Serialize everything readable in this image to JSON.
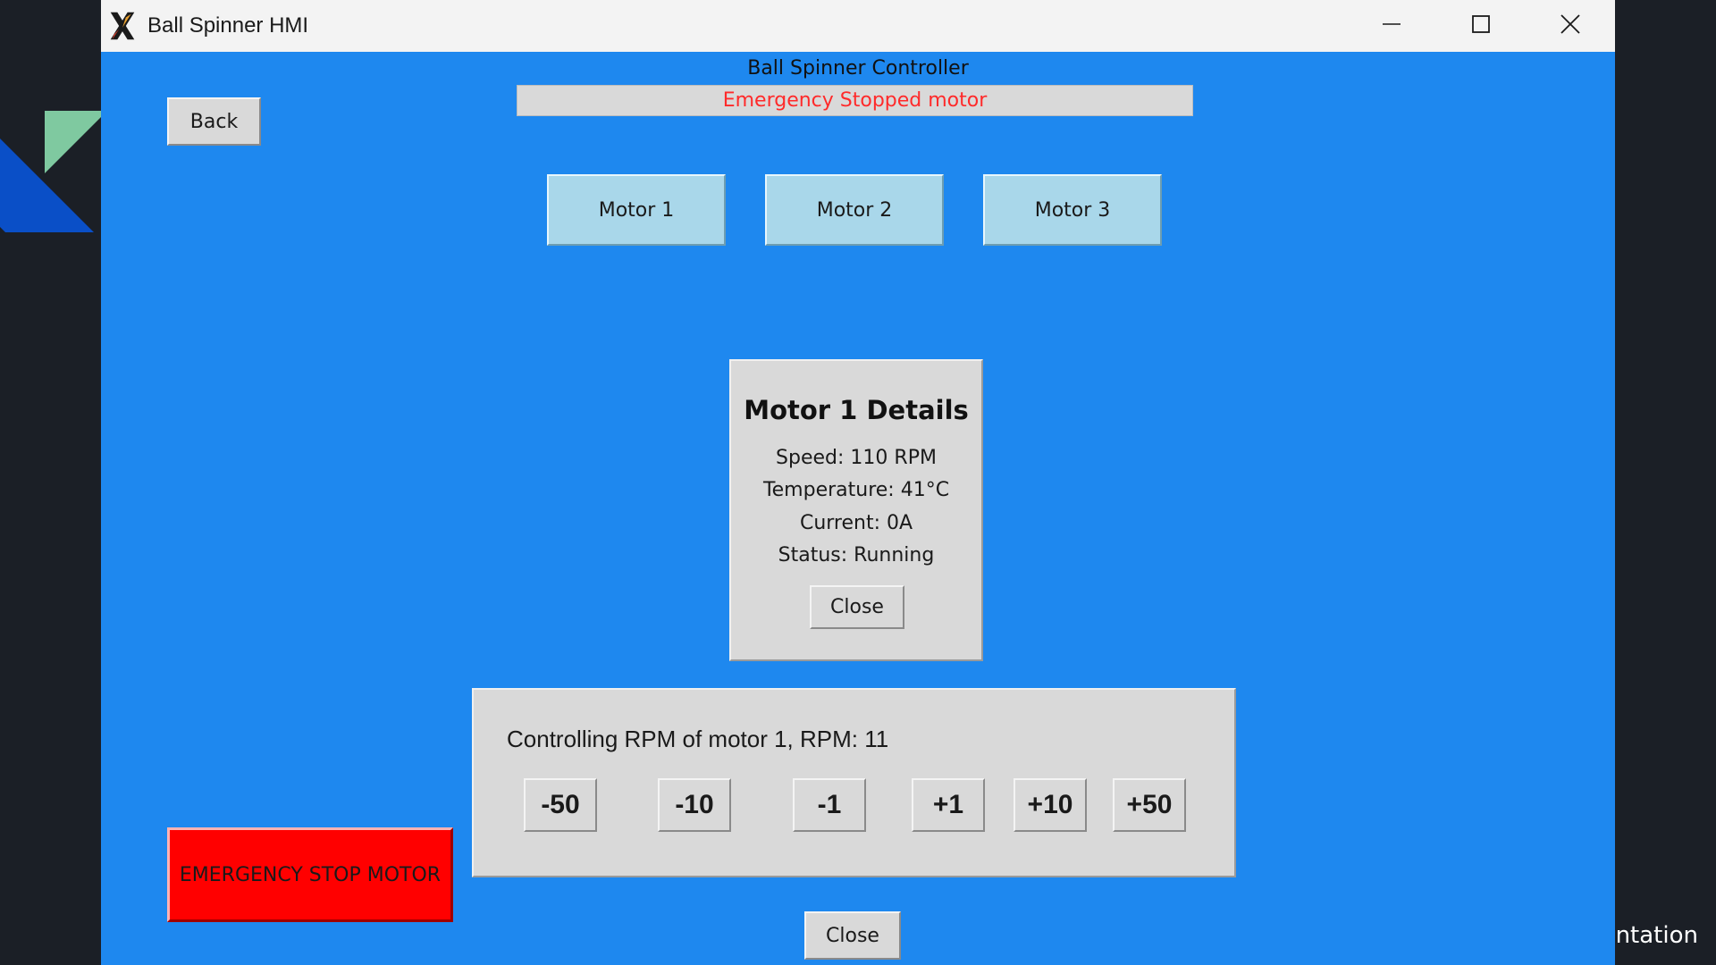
{
  "window": {
    "title": "Ball Spinner HMI",
    "icons": {
      "app": "x-logo-icon",
      "minimize": "minimize-icon",
      "maximize": "maximize-icon",
      "close": "close-icon"
    }
  },
  "header": {
    "title": "Ball Spinner Controller",
    "status_message": "Emergency Stopped motor",
    "status_color": "#ff2a2a"
  },
  "nav": {
    "back_label": "Back"
  },
  "motors": [
    {
      "label": "Motor 1"
    },
    {
      "label": "Motor 2"
    },
    {
      "label": "Motor 3"
    }
  ],
  "details": {
    "title": "Motor 1 Details",
    "speed": "Speed: 110 RPM",
    "temperature": "Temperature: 41°C",
    "current": "Current: 0A",
    "status": "Status: Running",
    "close_label": "Close"
  },
  "rpm_control": {
    "label": "Controlling RPM of motor 1, RPM: 11",
    "buttons": [
      "-50",
      "-10",
      "-1",
      "+1",
      "+10",
      "+50"
    ]
  },
  "emergency": {
    "label": "EMERGENCY STOP MOTOR",
    "color": "#ff0000"
  },
  "footer": {
    "close_label": "Close"
  },
  "desktop": {
    "background_text": "ntation"
  },
  "colors": {
    "window_bg": "#1e88ef",
    "motor_button": "#a9d7ea",
    "panel": "#d9d9d9"
  }
}
